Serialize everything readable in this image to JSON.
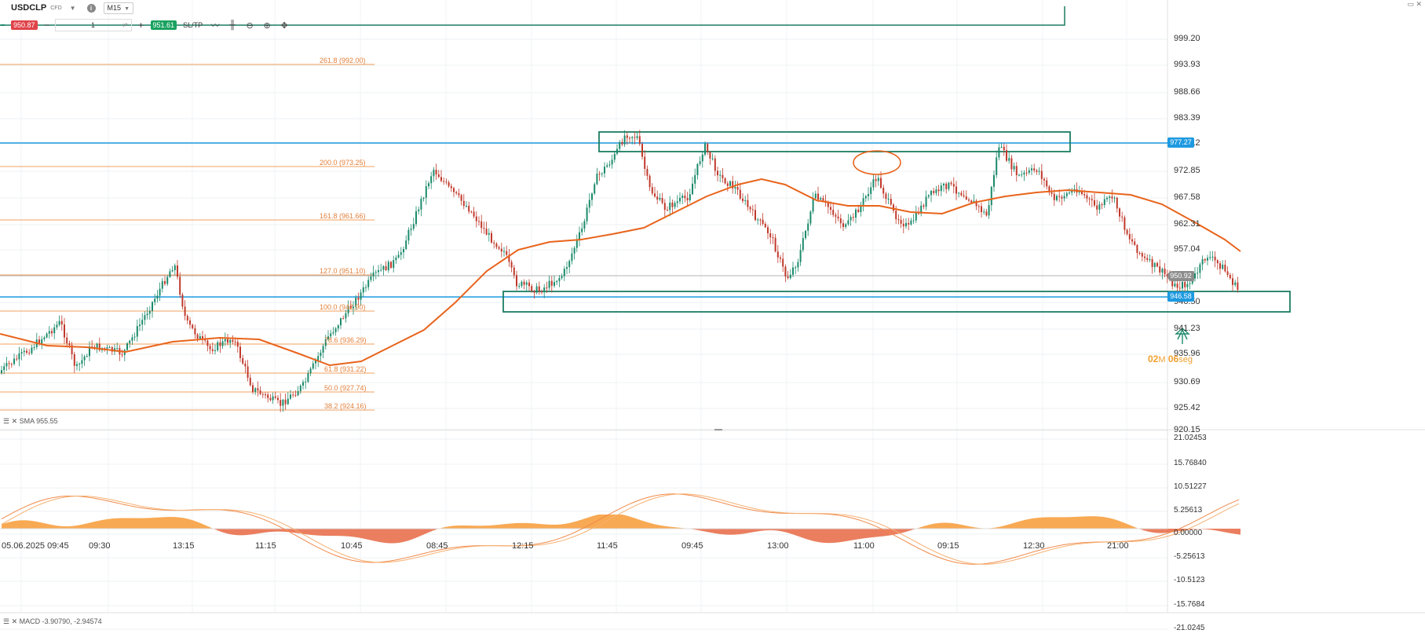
{
  "toolbar": {
    "symbol": "USDCLP",
    "instrument_type": "CFD",
    "info_glyph": "i",
    "timeframe": "M15",
    "sell_price": "950.87",
    "quantity": "1",
    "buy_price": "951.61",
    "sltp_label": "SL/TP",
    "icons": [
      "line-tool-icon",
      "candle-type-icon",
      "zoom-out-icon",
      "zoom-in-icon",
      "crosshair-move-icon"
    ]
  },
  "price_axis": {
    "labels": [
      "999.20",
      "993.93",
      "988.66",
      "983.39",
      "978.12",
      "972.85",
      "967.58",
      "962.31",
      "957.04",
      "946.50",
      "941.23",
      "935.96",
      "930.69",
      "925.42",
      "920.15"
    ],
    "tags": {
      "resistance": "977.27",
      "current": "950.92",
      "support": "946.58"
    }
  },
  "macd_axis": {
    "labels": [
      "21.02453",
      "15.76840",
      "10.51227",
      "5.25613",
      "0.00000",
      "-5.25613",
      "-10.5123",
      "-15.7684",
      "-21.0245"
    ]
  },
  "time_axis": {
    "labels": [
      "05.06.2025 09:45",
      "09:30",
      "13:15",
      "11:15",
      "10:45",
      "08:45",
      "12:15",
      "11:45",
      "09:45",
      "13:00",
      "11:00",
      "09:15",
      "12:30",
      "21:00"
    ]
  },
  "fibonacci": [
    "261.8 (992.00)",
    "200.0 (973.25)",
    "161.8 (961.66)",
    "127.0 (951.10)",
    "100.0 (942.90)",
    "78.6 (936.29)",
    "61.8 (931.22)",
    "50.0 (927.74)",
    "38.2 (924.16)"
  ],
  "indicators": {
    "sma_legend": "SMA 955.55",
    "macd_legend": "MACD -3.90790, -2.94574"
  },
  "countdown": {
    "min": "02",
    "min_unit": "M",
    "sec": "06",
    "sec_unit": "seg"
  },
  "colors": {
    "up": "#1b8a6b",
    "down": "#c0392b",
    "sma": "#e8641c",
    "fib": "#f0a060",
    "level": "#1e9ae0",
    "zone": "#1b7d62",
    "macd_pos": "#f7a040",
    "macd_neg": "#e8704e"
  },
  "window_controls": "▭ ✕"
}
